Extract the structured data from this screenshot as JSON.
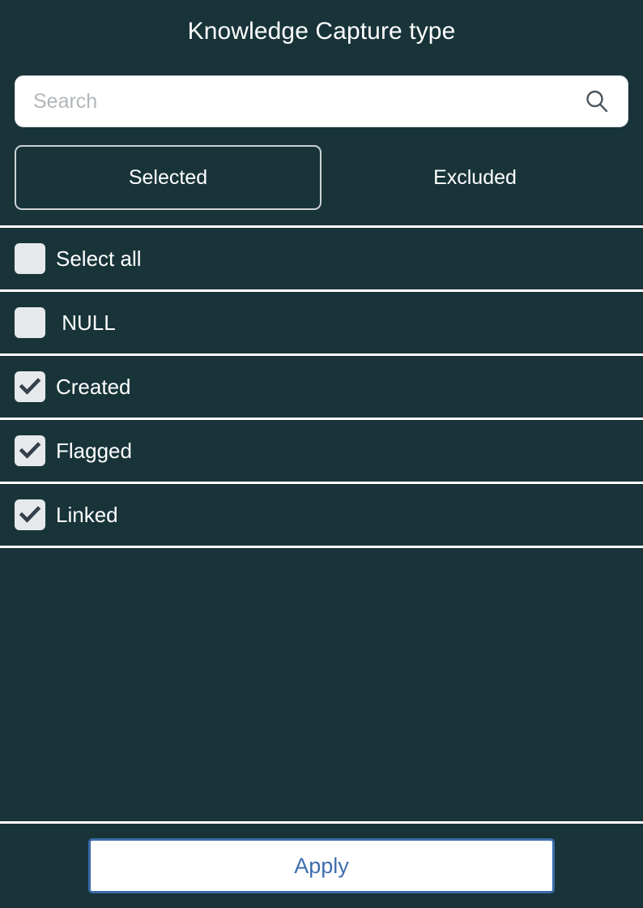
{
  "header": {
    "title": "Knowledge Capture type"
  },
  "search": {
    "placeholder": "Search",
    "value": "",
    "icon": "search-icon"
  },
  "tabs": [
    {
      "label": "Selected",
      "active": true
    },
    {
      "label": "Excluded",
      "active": false
    }
  ],
  "list": {
    "items": [
      {
        "label": "Select all",
        "checked": false
      },
      {
        "label": " NULL",
        "checked": false
      },
      {
        "label": "Created",
        "checked": true
      },
      {
        "label": "Flagged",
        "checked": true
      },
      {
        "label": "Linked",
        "checked": true
      }
    ]
  },
  "footer": {
    "apply_label": "Apply"
  },
  "colors": {
    "background": "#183439",
    "divider": "#ffffff",
    "checkbox_fill": "#e6e9eb",
    "check_mark": "#333f4a",
    "accent_blue": "#3d6eae",
    "tab_border": "#cdd3d6",
    "placeholder": "#b2b7bb"
  }
}
